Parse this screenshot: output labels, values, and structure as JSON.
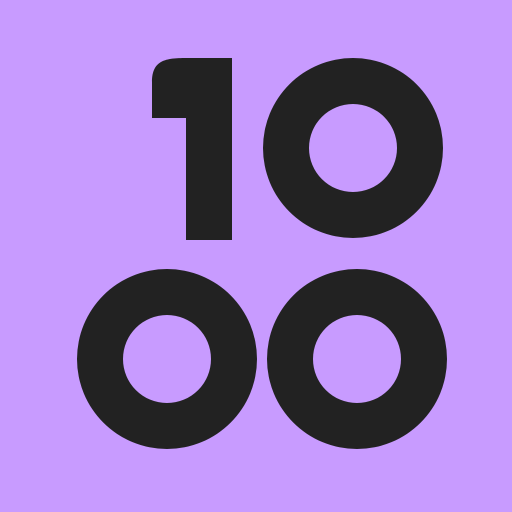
{
  "icon": {
    "digits": [
      "1",
      "0",
      "0",
      "0"
    ],
    "colors": {
      "background": "#c89bff",
      "foreground": "#222222"
    }
  }
}
